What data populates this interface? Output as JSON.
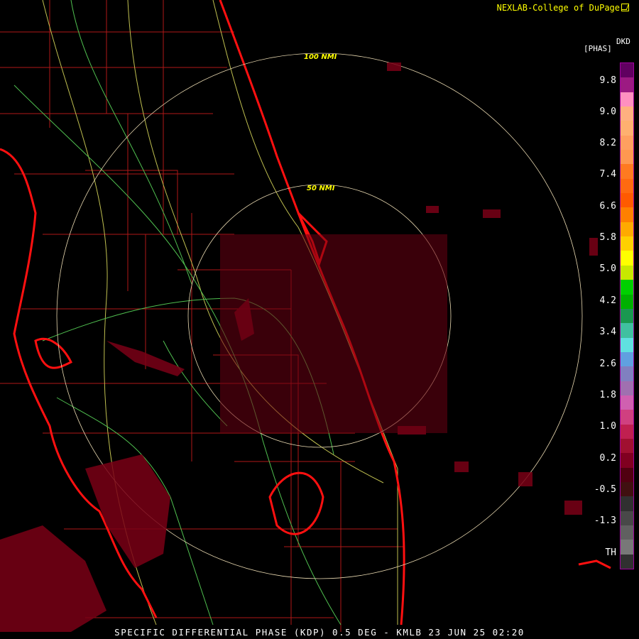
{
  "credit": "NEXLAB-College of DuPage",
  "legend": {
    "unit": "[PHAS]",
    "code": "DKD",
    "ticks": [
      "9.8",
      "9.0",
      "8.2",
      "7.4",
      "6.6",
      "5.8",
      "5.0",
      "4.2",
      "3.4",
      "2.6",
      "1.8",
      "1.0",
      "0.2",
      "-0.5",
      "-1.3",
      "TH"
    ],
    "colors": [
      "#600060",
      "#9c1a82",
      "#ff90c0",
      "#ffb080",
      "#ffb070",
      "#ffa060",
      "#ff9850",
      "#ff7a20",
      "#ff6a10",
      "#ff5a00",
      "#ff8000",
      "#ffaa00",
      "#ffd000",
      "#ffff00",
      "#c8e800",
      "#00d000",
      "#00b000",
      "#1a9850",
      "#40c0a0",
      "#60e0e0",
      "#60a0e0",
      "#8080c0",
      "#a070b0",
      "#d060b0",
      "#d04080",
      "#c02050",
      "#a01030",
      "#800020",
      "#500010",
      "#401010",
      "#303030",
      "#484848",
      "#606060",
      "#787878",
      "#303030"
    ]
  },
  "range_rings": [
    {
      "label": "100 NMI",
      "radius_nmi": 100
    },
    {
      "label": "50 NMI",
      "radius_nmi": 50
    }
  ],
  "footer": "SPECIFIC DIFFERENTIAL PHASE (KDP) 0.5 DEG - KMLB 23 JUN 25 02:20"
}
